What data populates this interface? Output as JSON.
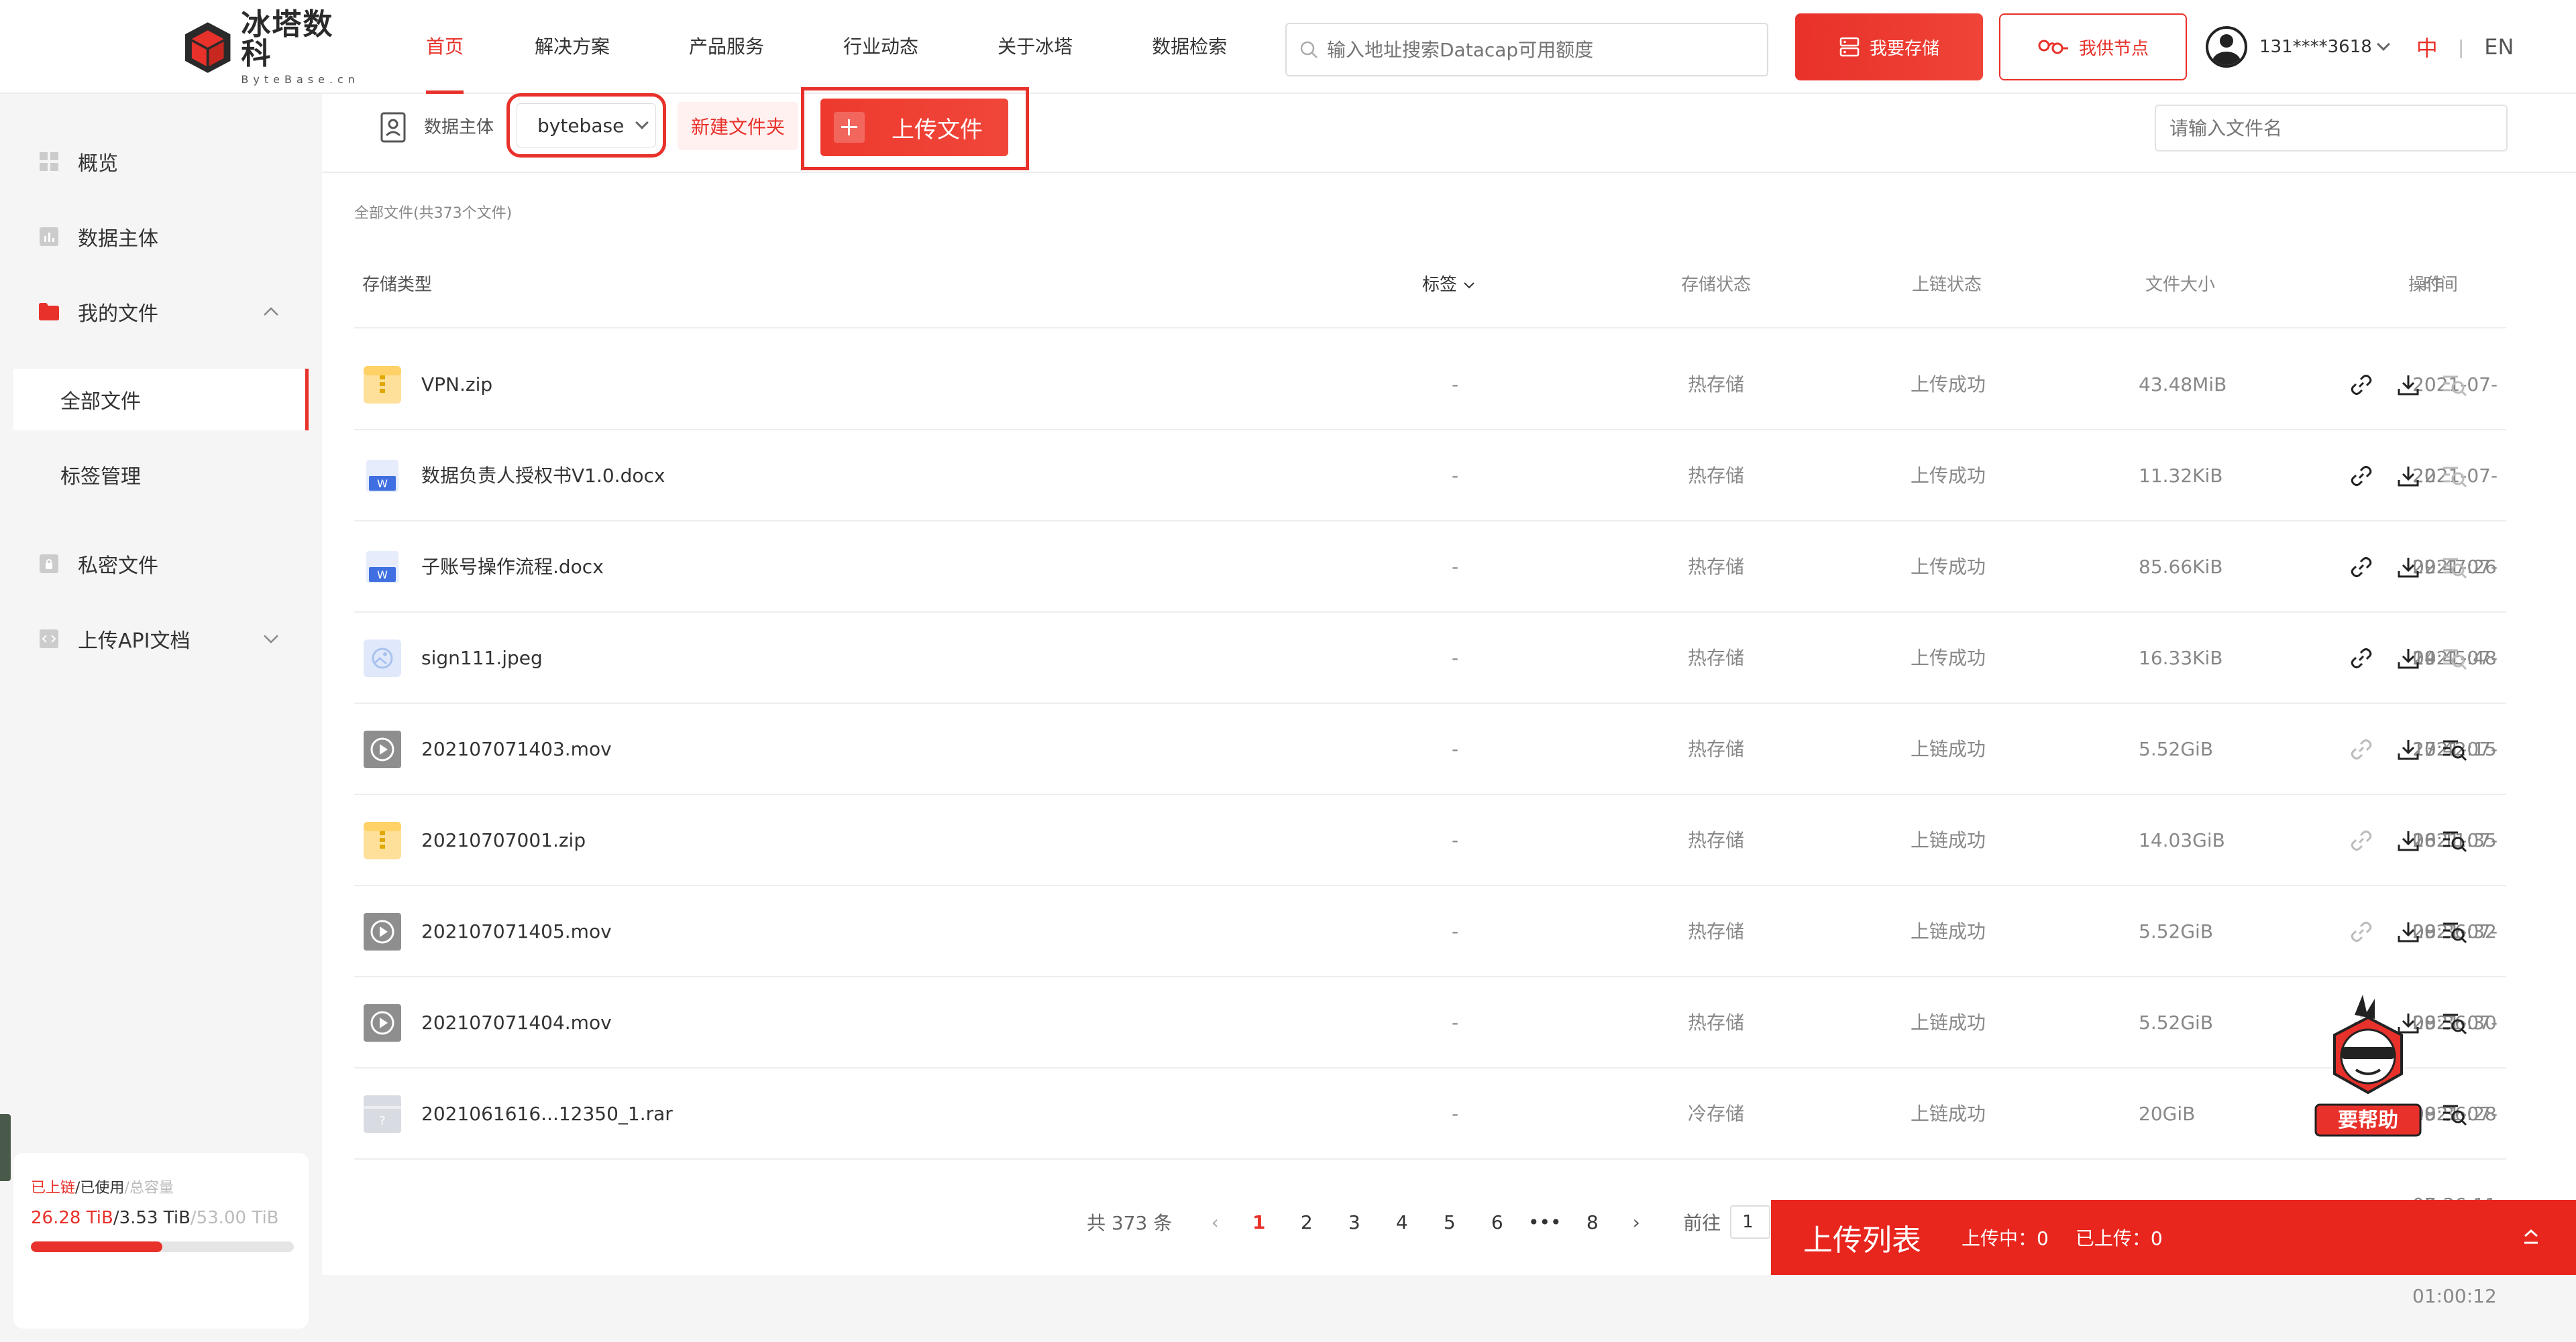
{
  "logo": {
    "cn": "冰塔数科",
    "en": "ByteBase.cn"
  },
  "nav": [
    {
      "label": "首页",
      "active": true
    },
    {
      "label": "解决方案",
      "active": false
    },
    {
      "label": "产品服务",
      "active": false
    },
    {
      "label": "行业动态",
      "active": false
    },
    {
      "label": "关于冰塔",
      "active": false
    },
    {
      "label": "数据检索",
      "active": false
    }
  ],
  "search": {
    "placeholder": "输入地址搜索Datacap可用额度"
  },
  "header_buttons": {
    "store": "我要存储",
    "node": "我供节点"
  },
  "user": {
    "phone": "131****3618",
    "lang_zh": "中",
    "lang_sep": "|",
    "lang_en": "EN"
  },
  "sidebar": {
    "overview": "概览",
    "subject": "数据主体",
    "my_files": "我的文件",
    "all_files": "全部文件",
    "tag_manage": "标签管理",
    "private_files": "私密文件",
    "api_docs": "上传API文档"
  },
  "usage": {
    "label_chained": "已上链",
    "label_used": "/已使用",
    "label_total": "/总容量",
    "chained": "26.28 TiB",
    "used": "/3.53 TiB",
    "total": "/53.00 TiB",
    "fill_fraction": 0.5
  },
  "toolbar": {
    "subject_label": "数据主体",
    "subject_value": "bytebase",
    "new_folder": "新建文件夹",
    "upload": "上传文件",
    "filename_placeholder": "请输入文件名"
  },
  "file_count": "全部文件(共373个文件)",
  "columns": {
    "type": "存储类型",
    "tag": "标签",
    "storage_status": "存储状态",
    "chain_status": "上链状态",
    "size": "文件大小",
    "time": "时间",
    "ops": "操作"
  },
  "files": [
    {
      "name": "VPN.zip",
      "kind": "zip",
      "tag": "-",
      "storage": "热存储",
      "chain": "上传成功",
      "size": "43.48MiB",
      "time": "2021-07-22 09:47:26"
    },
    {
      "name": "数据负责人授权书V1.0.docx",
      "kind": "docx",
      "tag": "-",
      "storage": "热存储",
      "chain": "上传成功",
      "size": "11.32KiB",
      "time": "2021-07-22 09:45:48"
    },
    {
      "name": "子账号操作流程.docx",
      "kind": "docx",
      "tag": "-",
      "storage": "热存储",
      "chain": "上传成功",
      "size": "85.66KiB",
      "time": "2021-07-14 17:42:15"
    },
    {
      "name": "sign111.jpeg",
      "kind": "image",
      "tag": "-",
      "storage": "热存储",
      "chain": "上传成功",
      "size": "16.33KiB",
      "time": "2021-07-13 16:11:35"
    },
    {
      "name": "202107071403.mov",
      "kind": "video",
      "tag": "-",
      "storage": "热存储",
      "chain": "上链成功",
      "size": "5.52GiB",
      "time": "2021-07-08 09:36:32"
    },
    {
      "name": "20210707001.zip",
      "kind": "zip",
      "tag": "-",
      "storage": "热存储",
      "chain": "上链成功",
      "size": "14.03GiB",
      "time": "2021-07-08 09:36:30"
    },
    {
      "name": "202107071405.mov",
      "kind": "video",
      "tag": "-",
      "storage": "热存储",
      "chain": "上链成功",
      "size": "5.52GiB",
      "time": "2021-07-08 09:36:28"
    },
    {
      "name": "202107071404.mov",
      "kind": "video",
      "tag": "-",
      "storage": "热存储",
      "chain": "上链成功",
      "size": "5.52GiB",
      "time": "2021-07-08 09:36:11"
    },
    {
      "name": "2021061616...12350_1.rar",
      "kind": "rar",
      "tag": "-",
      "storage": "冷存储",
      "chain": "上链成功",
      "size": "20GiB",
      "time": "2021-07-07 01:00:12"
    }
  ],
  "pagination": {
    "total": "共 373 条",
    "pages": [
      "1",
      "2",
      "3",
      "4",
      "5",
      "6",
      "•••",
      "8"
    ],
    "current": "1",
    "goto_label": "前往",
    "goto_value": "1"
  },
  "upload_panel": {
    "title": "上传列表",
    "uploading": "上传中：0",
    "uploaded": "已上传：0"
  },
  "help": {
    "label": "要帮助"
  },
  "colors": {
    "accent": "#e8312a",
    "panel": "#e8261e"
  }
}
